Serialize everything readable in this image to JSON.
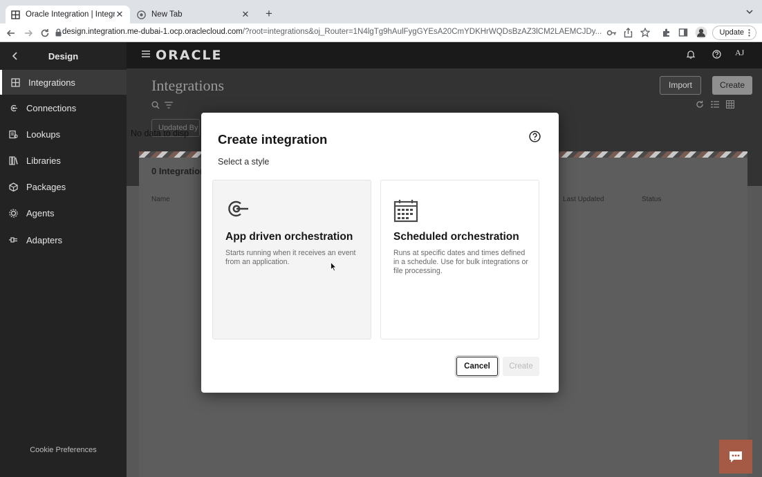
{
  "browser": {
    "tabs": [
      {
        "title": "Oracle Integration | Integration",
        "icon": "grid-icon"
      },
      {
        "title": "New Tab",
        "icon": "chrome-icon"
      }
    ],
    "new_tab_symbol": "+",
    "url_host": "design.integration.me-dubai-1.ocp.oraclecloud.com",
    "url_path": "/?root=integrations&oj_Router=1N4lgTg9hAulFygGYEsA20CmYDKHrWQDsBzAZ3lCM2LAEMCJDy...",
    "update_label": "Update"
  },
  "sidebar": {
    "title": "Design",
    "items": [
      {
        "label": "Integrations",
        "icon": "integrations-icon",
        "active": true
      },
      {
        "label": "Connections",
        "icon": "connections-icon"
      },
      {
        "label": "Lookups",
        "icon": "lookups-icon"
      },
      {
        "label": "Libraries",
        "icon": "libraries-icon"
      },
      {
        "label": "Packages",
        "icon": "packages-icon"
      },
      {
        "label": "Agents",
        "icon": "agents-icon"
      },
      {
        "label": "Adapters",
        "icon": "adapters-icon"
      }
    ],
    "footer": "Cookie Preferences"
  },
  "header": {
    "logo": "ORACLE",
    "user_initials": "AJ"
  },
  "page": {
    "title": "Integrations",
    "import_label": "Import",
    "create_label": "Create",
    "filter_chip": "Updated By",
    "count_label": "0 Integrations",
    "columns": [
      "Name",
      "Last Updated",
      "Status"
    ],
    "empty_text": "No data to display"
  },
  "dialog": {
    "title": "Create integration",
    "subtitle": "Select a style",
    "options": [
      {
        "title": "App driven orchestration",
        "description": "Starts running when it receives an event from an application.",
        "icon": "app-driven-icon",
        "selected": true
      },
      {
        "title": "Scheduled orchestration",
        "description": "Runs at specific dates and times defined in a schedule. Use for bulk integrations or file processing.",
        "icon": "calendar-icon",
        "selected": false
      }
    ],
    "cancel_label": "Cancel",
    "create_label": "Create"
  },
  "colors": {
    "sidebar_bg": "#232323",
    "chat_button": "#a55a46",
    "dialog_bg": "#ffffff"
  }
}
